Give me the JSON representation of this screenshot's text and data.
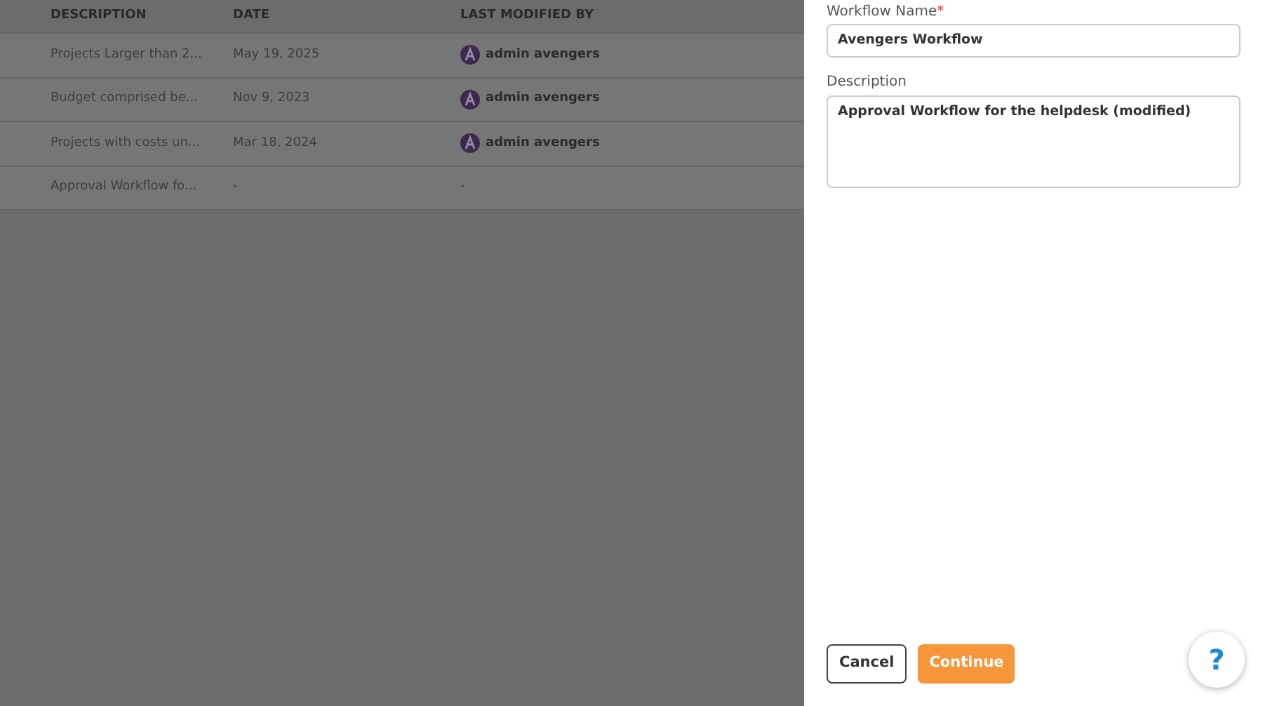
{
  "table": {
    "columns": [
      "DESCRIPTION",
      "DATE",
      "LAST MODIFIED BY"
    ],
    "rows": [
      {
        "description": "Projects Larger than 2...",
        "date": "May 19, 2025",
        "modified_by": "admin avengers",
        "avatar": true
      },
      {
        "description": "Budget comprised be...",
        "date": "Nov 9, 2023",
        "modified_by": "admin avengers",
        "avatar": true
      },
      {
        "description": "Projects with costs un...",
        "date": "Mar 18, 2024",
        "modified_by": "admin avengers",
        "avatar": true
      },
      {
        "description": "Approval Workflow fo...",
        "date": "-",
        "modified_by": "-",
        "avatar": false
      }
    ]
  },
  "panel": {
    "name_label": "Workflow Name",
    "required_mark": "*",
    "name_value": "Avengers Workflow",
    "description_label": "Description",
    "description_value": "Approval Workflow for the helpdesk (modified)",
    "buttons": [
      {
        "label": "Cancel",
        "kind": "outline"
      },
      {
        "label": "Continue",
        "kind": "primary"
      }
    ],
    "help": "?"
  }
}
